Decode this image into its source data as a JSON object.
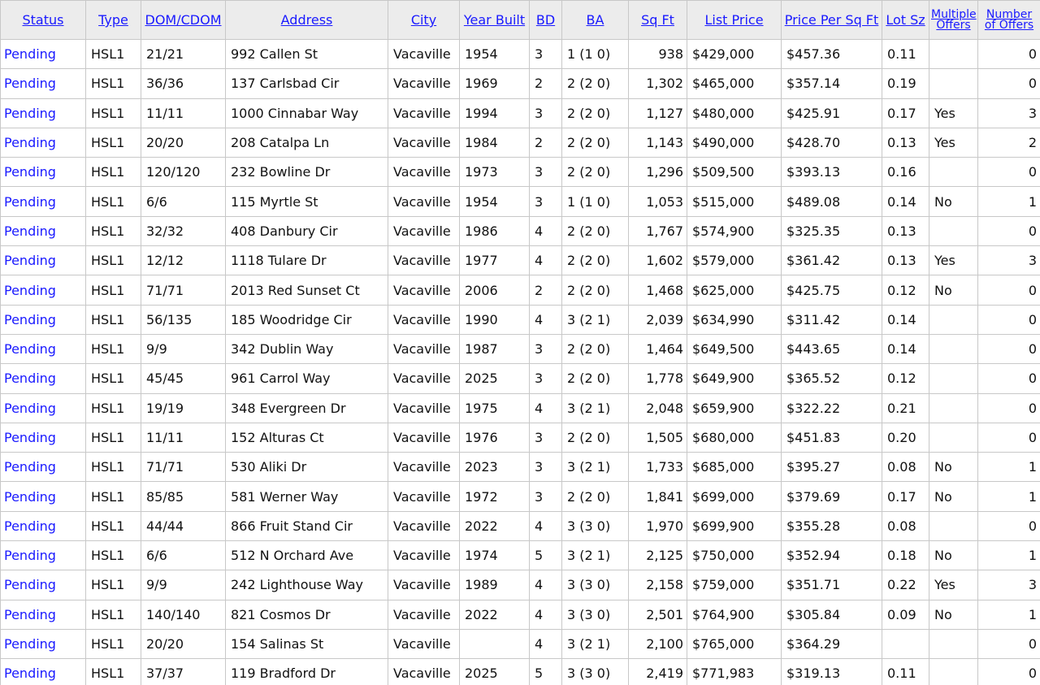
{
  "headers": [
    {
      "key": "status",
      "label": "Status"
    },
    {
      "key": "type",
      "label": "Type"
    },
    {
      "key": "dom",
      "label": "DOM/CDOM"
    },
    {
      "key": "address",
      "label": "Address"
    },
    {
      "key": "city",
      "label": "City"
    },
    {
      "key": "year",
      "label": "Year Built"
    },
    {
      "key": "bd",
      "label": "BD"
    },
    {
      "key": "ba",
      "label": "BA"
    },
    {
      "key": "sqft",
      "label": "Sq Ft"
    },
    {
      "key": "price",
      "label": "List Price"
    },
    {
      "key": "ppsf",
      "label": "Price Per Sq Ft"
    },
    {
      "key": "lot",
      "label": "Lot Sz"
    },
    {
      "key": "multi",
      "label": "Multiple Offers"
    },
    {
      "key": "offers",
      "label": "Number of Offers"
    }
  ],
  "rows": [
    {
      "status": "Pending",
      "type": "HSL1",
      "dom": "21/21",
      "address": "992 Callen St",
      "city": "Vacaville",
      "year": "1954",
      "bd": "3",
      "ba": "1 (1 0)",
      "sqft": "938",
      "price": "$429,000",
      "ppsf": "$457.36",
      "lot": "0.11",
      "multi": "",
      "offers": "0"
    },
    {
      "status": "Pending",
      "type": "HSL1",
      "dom": "36/36",
      "address": "137 Carlsbad Cir",
      "city": "Vacaville",
      "year": "1969",
      "bd": "2",
      "ba": "2 (2 0)",
      "sqft": "1,302",
      "price": "$465,000",
      "ppsf": "$357.14",
      "lot": "0.19",
      "multi": "",
      "offers": "0"
    },
    {
      "status": "Pending",
      "type": "HSL1",
      "dom": "11/11",
      "address": "1000 Cinnabar Way",
      "city": "Vacaville",
      "year": "1994",
      "bd": "3",
      "ba": "2 (2 0)",
      "sqft": "1,127",
      "price": "$480,000",
      "ppsf": "$425.91",
      "lot": "0.17",
      "multi": "Yes",
      "offers": "3"
    },
    {
      "status": "Pending",
      "type": "HSL1",
      "dom": "20/20",
      "address": "208 Catalpa Ln",
      "city": "Vacaville",
      "year": "1984",
      "bd": "2",
      "ba": "2 (2 0)",
      "sqft": "1,143",
      "price": "$490,000",
      "ppsf": "$428.70",
      "lot": "0.13",
      "multi": "Yes",
      "offers": "2"
    },
    {
      "status": "Pending",
      "type": "HSL1",
      "dom": "120/120",
      "address": "232 Bowline Dr",
      "city": "Vacaville",
      "year": "1973",
      "bd": "3",
      "ba": "2 (2 0)",
      "sqft": "1,296",
      "price": "$509,500",
      "ppsf": "$393.13",
      "lot": "0.16",
      "multi": "",
      "offers": "0"
    },
    {
      "status": "Pending",
      "type": "HSL1",
      "dom": "6/6",
      "address": "115 Myrtle St",
      "city": "Vacaville",
      "year": "1954",
      "bd": "3",
      "ba": "1 (1 0)",
      "sqft": "1,053",
      "price": "$515,000",
      "ppsf": "$489.08",
      "lot": "0.14",
      "multi": "No",
      "offers": "1"
    },
    {
      "status": "Pending",
      "type": "HSL1",
      "dom": "32/32",
      "address": "408 Danbury Cir",
      "city": "Vacaville",
      "year": "1986",
      "bd": "4",
      "ba": "2 (2 0)",
      "sqft": "1,767",
      "price": "$574,900",
      "ppsf": "$325.35",
      "lot": "0.13",
      "multi": "",
      "offers": "0"
    },
    {
      "status": "Pending",
      "type": "HSL1",
      "dom": "12/12",
      "address": "1118 Tulare Dr",
      "city": "Vacaville",
      "year": "1977",
      "bd": "4",
      "ba": "2 (2 0)",
      "sqft": "1,602",
      "price": "$579,000",
      "ppsf": "$361.42",
      "lot": "0.13",
      "multi": "Yes",
      "offers": "3"
    },
    {
      "status": "Pending",
      "type": "HSL1",
      "dom": "71/71",
      "address": "2013 Red Sunset Ct",
      "city": "Vacaville",
      "year": "2006",
      "bd": "2",
      "ba": "2 (2 0)",
      "sqft": "1,468",
      "price": "$625,000",
      "ppsf": "$425.75",
      "lot": "0.12",
      "multi": "No",
      "offers": "0"
    },
    {
      "status": "Pending",
      "type": "HSL1",
      "dom": "56/135",
      "address": "185 Woodridge Cir",
      "city": "Vacaville",
      "year": "1990",
      "bd": "4",
      "ba": "3 (2 1)",
      "sqft": "2,039",
      "price": "$634,990",
      "ppsf": "$311.42",
      "lot": "0.14",
      "multi": "",
      "offers": "0"
    },
    {
      "status": "Pending",
      "type": "HSL1",
      "dom": "9/9",
      "address": "342 Dublin Way",
      "city": "Vacaville",
      "year": "1987",
      "bd": "3",
      "ba": "2 (2 0)",
      "sqft": "1,464",
      "price": "$649,500",
      "ppsf": "$443.65",
      "lot": "0.14",
      "multi": "",
      "offers": "0"
    },
    {
      "status": "Pending",
      "type": "HSL1",
      "dom": "45/45",
      "address": "961 Carrol Way",
      "city": "Vacaville",
      "year": "2025",
      "bd": "3",
      "ba": "2 (2 0)",
      "sqft": "1,778",
      "price": "$649,900",
      "ppsf": "$365.52",
      "lot": "0.12",
      "multi": "",
      "offers": "0"
    },
    {
      "status": "Pending",
      "type": "HSL1",
      "dom": "19/19",
      "address": "348 Evergreen Dr",
      "city": "Vacaville",
      "year": "1975",
      "bd": "4",
      "ba": "3 (2 1)",
      "sqft": "2,048",
      "price": "$659,900",
      "ppsf": "$322.22",
      "lot": "0.21",
      "multi": "",
      "offers": "0"
    },
    {
      "status": "Pending",
      "type": "HSL1",
      "dom": "11/11",
      "address": "152 Alturas Ct",
      "city": "Vacaville",
      "year": "1976",
      "bd": "3",
      "ba": "2 (2 0)",
      "sqft": "1,505",
      "price": "$680,000",
      "ppsf": "$451.83",
      "lot": "0.20",
      "multi": "",
      "offers": "0"
    },
    {
      "status": "Pending",
      "type": "HSL1",
      "dom": "71/71",
      "address": "530 Aliki Dr",
      "city": "Vacaville",
      "year": "2023",
      "bd": "3",
      "ba": "3 (2 1)",
      "sqft": "1,733",
      "price": "$685,000",
      "ppsf": "$395.27",
      "lot": "0.08",
      "multi": "No",
      "offers": "1"
    },
    {
      "status": "Pending",
      "type": "HSL1",
      "dom": "85/85",
      "address": "581 Werner Way",
      "city": "Vacaville",
      "year": "1972",
      "bd": "3",
      "ba": "2 (2 0)",
      "sqft": "1,841",
      "price": "$699,000",
      "ppsf": "$379.69",
      "lot": "0.17",
      "multi": "No",
      "offers": "1"
    },
    {
      "status": "Pending",
      "type": "HSL1",
      "dom": "44/44",
      "address": "866 Fruit Stand Cir",
      "city": "Vacaville",
      "year": "2022",
      "bd": "4",
      "ba": "3 (3 0)",
      "sqft": "1,970",
      "price": "$699,900",
      "ppsf": "$355.28",
      "lot": "0.08",
      "multi": "",
      "offers": "0"
    },
    {
      "status": "Pending",
      "type": "HSL1",
      "dom": "6/6",
      "address": "512 N Orchard Ave",
      "city": "Vacaville",
      "year": "1974",
      "bd": "5",
      "ba": "3 (2 1)",
      "sqft": "2,125",
      "price": "$750,000",
      "ppsf": "$352.94",
      "lot": "0.18",
      "multi": "No",
      "offers": "1"
    },
    {
      "status": "Pending",
      "type": "HSL1",
      "dom": "9/9",
      "address": "242 Lighthouse Way",
      "city": "Vacaville",
      "year": "1989",
      "bd": "4",
      "ba": "3 (3 0)",
      "sqft": "2,158",
      "price": "$759,000",
      "ppsf": "$351.71",
      "lot": "0.22",
      "multi": "Yes",
      "offers": "3"
    },
    {
      "status": "Pending",
      "type": "HSL1",
      "dom": "140/140",
      "address": "821 Cosmos Dr",
      "city": "Vacaville",
      "year": "2022",
      "bd": "4",
      "ba": "3 (3 0)",
      "sqft": "2,501",
      "price": "$764,900",
      "ppsf": "$305.84",
      "lot": "0.09",
      "multi": "No",
      "offers": "1"
    },
    {
      "status": "Pending",
      "type": "HSL1",
      "dom": "20/20",
      "address": "154 Salinas St",
      "city": "Vacaville",
      "year": "",
      "bd": "4",
      "ba": "3 (2 1)",
      "sqft": "2,100",
      "price": "$765,000",
      "ppsf": "$364.29",
      "lot": "",
      "multi": "",
      "offers": "0"
    },
    {
      "status": "Pending",
      "type": "HSL1",
      "dom": "37/37",
      "address": "119 Bradford Dr",
      "city": "Vacaville",
      "year": "2025",
      "bd": "5",
      "ba": "3 (3 0)",
      "sqft": "2,419",
      "price": "$771,983",
      "ppsf": "$319.13",
      "lot": "0.11",
      "multi": "",
      "offers": "0"
    }
  ]
}
